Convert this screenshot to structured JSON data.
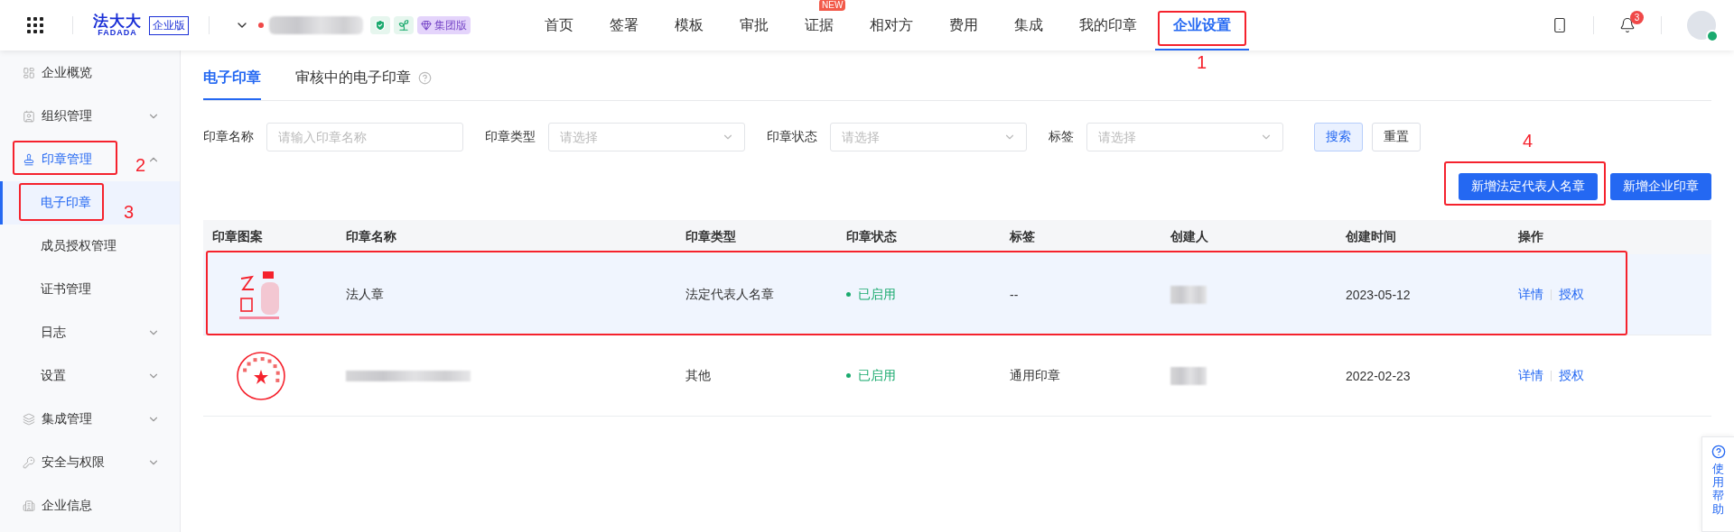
{
  "header": {
    "logo": {
      "name": "法大大",
      "latin": "FADADA",
      "edition": "企业版"
    },
    "company": {
      "plan": "集团版"
    },
    "nav": [
      {
        "label": "首页",
        "selected": false
      },
      {
        "label": "签署",
        "selected": false
      },
      {
        "label": "模板",
        "selected": false
      },
      {
        "label": "审批",
        "selected": false
      },
      {
        "label": "证据",
        "selected": false,
        "badge": "NEW"
      },
      {
        "label": "相对方",
        "selected": false
      },
      {
        "label": "费用",
        "selected": false
      },
      {
        "label": "集成",
        "selected": false
      },
      {
        "label": "我的印章",
        "selected": false
      },
      {
        "label": "企业设置",
        "selected": true,
        "annotation": "1"
      }
    ],
    "notifications": "3"
  },
  "sidebar": {
    "items": [
      {
        "label": "企业概览",
        "selected": false
      },
      {
        "label": "组织管理",
        "selected": false,
        "expanded": false
      },
      {
        "label": "印章管理",
        "selected": true,
        "expanded": true,
        "annotation": "2",
        "children": [
          {
            "label": "电子印章",
            "selected": true,
            "annotation": "3"
          },
          {
            "label": "成员授权管理",
            "selected": false
          },
          {
            "label": "证书管理",
            "selected": false
          },
          {
            "label": "日志",
            "selected": false,
            "expanded": false
          },
          {
            "label": "设置",
            "selected": false,
            "expanded": false
          }
        ]
      },
      {
        "label": "集成管理",
        "selected": false,
        "expanded": false
      },
      {
        "label": "安全与权限",
        "selected": false,
        "expanded": false
      },
      {
        "label": "企业信息",
        "selected": false
      }
    ]
  },
  "tabs": [
    {
      "label": "电子印章",
      "selected": true
    },
    {
      "label": "审核中的电子印章",
      "selected": false,
      "help": true
    }
  ],
  "filters": [
    {
      "label": "印章名称",
      "kind": "input",
      "placeholder": "请输入印章名称"
    },
    {
      "label": "印章类型",
      "kind": "select",
      "placeholder": "请选择"
    },
    {
      "label": "印章状态",
      "kind": "select",
      "placeholder": "请选择"
    },
    {
      "label": "标签",
      "kind": "select",
      "placeholder": "请选择"
    }
  ],
  "filter_buttons": [
    {
      "label": "搜索",
      "kind": "search"
    },
    {
      "label": "重置",
      "kind": "reset"
    }
  ],
  "actions": [
    {
      "label": "新增法定代表人名章",
      "annotation": "4"
    },
    {
      "label": "新增企业印章"
    }
  ],
  "table": {
    "columns": [
      "印章图案",
      "印章名称",
      "印章类型",
      "印章状态",
      "标签",
      "创建人",
      "创建时间",
      "操作"
    ],
    "rows": [
      {
        "kind": "square",
        "name": "法人章",
        "type": "法定代表人名章",
        "status": {
          "label": "已启用",
          "kind": "enabled"
        },
        "tag": "--",
        "created": "2023-05-12",
        "actions": [
          "详情",
          "授权"
        ],
        "selected": true,
        "marked": true
      },
      {
        "kind": "round",
        "type": "其他",
        "status": {
          "label": "已启用",
          "kind": "enabled"
        },
        "tag": "通用印章",
        "created": "2022-02-23",
        "actions": [
          "详情",
          "授权"
        ],
        "selected": false,
        "marked": false
      }
    ]
  },
  "help_widget": {
    "label": "使用帮助"
  }
}
